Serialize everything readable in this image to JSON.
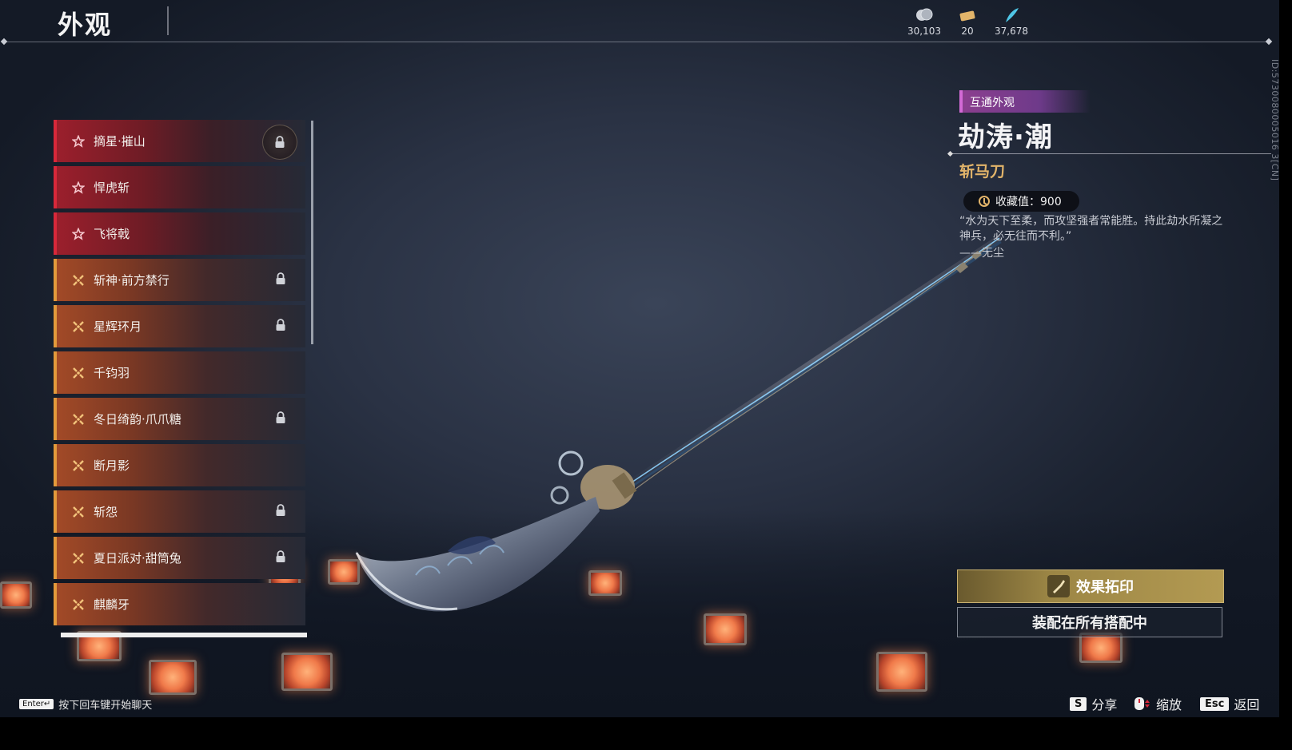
{
  "header": {
    "title": "外观",
    "currencies": [
      {
        "icon": "silver-coin-icon",
        "value": "30,103"
      },
      {
        "icon": "ticket-icon",
        "value": "20"
      },
      {
        "icon": "feather-icon",
        "value": "37,678"
      }
    ]
  },
  "list": {
    "items": [
      {
        "label": "摘星·摧山",
        "tier": "red",
        "locked": true
      },
      {
        "label": "悍虎斩",
        "tier": "red",
        "locked": false
      },
      {
        "label": "飞将戟",
        "tier": "red",
        "locked": false
      },
      {
        "label": "斩神·前方禁行",
        "tier": "orange",
        "locked": true
      },
      {
        "label": "星辉环月",
        "tier": "orange",
        "locked": true
      },
      {
        "label": "千钧羽",
        "tier": "orange",
        "locked": false
      },
      {
        "label": "冬日绮韵·爪爪糖",
        "tier": "orange",
        "locked": true
      },
      {
        "label": "断月影",
        "tier": "orange",
        "locked": false
      },
      {
        "label": "斩怨",
        "tier": "orange",
        "locked": true
      },
      {
        "label": "夏日派对·甜筒兔",
        "tier": "orange",
        "locked": true
      },
      {
        "label": "麒麟牙",
        "tier": "orange",
        "locked": false
      }
    ]
  },
  "detail": {
    "tag": "互通外观",
    "name": "劫涛·潮",
    "type": "斩马刀",
    "collect": "收藏值：900",
    "quote": "“水为天下至柔，而攻坚强者常能胜。持此劫水所凝之神兵，必无往而不利。”",
    "author": "——无尘",
    "id_text": "ID:5730080005016 3[CN]",
    "effect_button": "效果拓印",
    "equip_button": "装配在所有搭配中"
  },
  "footer": {
    "chat_key": "Enter↵",
    "chat_hint": "按下回车键开始聊天",
    "share_key": "S",
    "share": "分享",
    "zoom": "缩放",
    "back_key": "Esc",
    "back": "返回"
  },
  "colors": {
    "red_tier": "#d8283a",
    "orange_tier": "#e39a3b",
    "gold": "#e2b46a",
    "purple_tag": "#8b3f8f"
  }
}
